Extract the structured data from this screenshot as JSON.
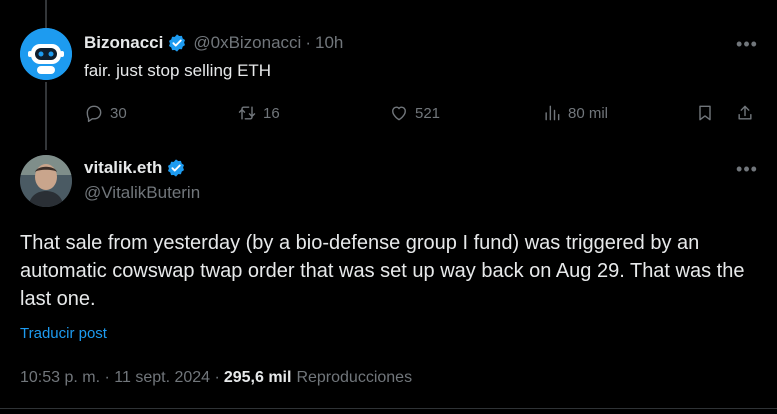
{
  "reply": {
    "name": "Bizonacci",
    "handle": "@0xBizonacci",
    "separator": "·",
    "time": "10h",
    "text": "fair. just stop selling ETH",
    "actions": {
      "replies": "30",
      "reposts": "16",
      "likes": "521",
      "views": "80 mil"
    }
  },
  "main": {
    "name": "vitalik.eth",
    "handle": "@VitalikButerin",
    "text": "That sale from yesterday (by a bio-defense group I fund) was triggered by an automatic cowswap twap order that was set up way back on Aug 29. That was the last one.",
    "translate_label": "Traducir post",
    "timestamp": "10:53 p. m. · 11 sept. 2024 ·",
    "views_count": "295,6 mil",
    "views_label": "Reproducciones"
  },
  "icons": {
    "verified": "verified-badge-icon",
    "more": "more-icon",
    "reply": "reply-icon",
    "repost": "repost-icon",
    "like": "heart-icon",
    "views": "views-icon",
    "bookmark": "bookmark-icon",
    "share": "share-icon"
  },
  "colors": {
    "background": "#000000",
    "text_primary": "#e7e9ea",
    "text_secondary": "#71767b",
    "accent": "#1d9bf0"
  }
}
